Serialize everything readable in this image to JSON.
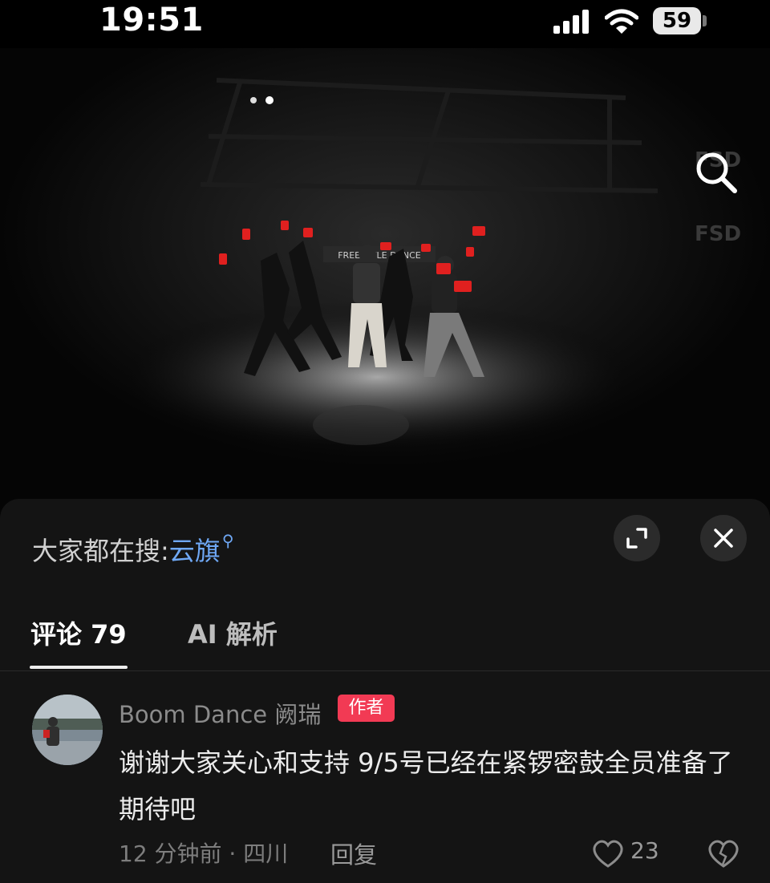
{
  "status_bar": {
    "time": "19:51",
    "battery": "59"
  },
  "video": {
    "banner_text": "FREESTYLE DANCE",
    "wall_logos": [
      "FSD",
      "FSD"
    ]
  },
  "sheet": {
    "trending_prefix": "大家都在搜:",
    "trending_keyword": "云旗",
    "tabs": [
      {
        "label": "评论 79",
        "active": true
      },
      {
        "label": "AI 解析",
        "active": false
      }
    ]
  },
  "comment": {
    "author": "Boom Dance 阙瑞",
    "badge": "作者",
    "text": "谢谢大家关心和支持 9/5号已经在紧锣密鼓全员准备了 期待吧",
    "meta": "12 分钟前 · 四川",
    "reply_label": "回复",
    "likes": "23"
  },
  "colors": {
    "accent_blue": "#6fa8f5",
    "author_badge": "#f23a54",
    "sheet_bg": "#141414"
  }
}
